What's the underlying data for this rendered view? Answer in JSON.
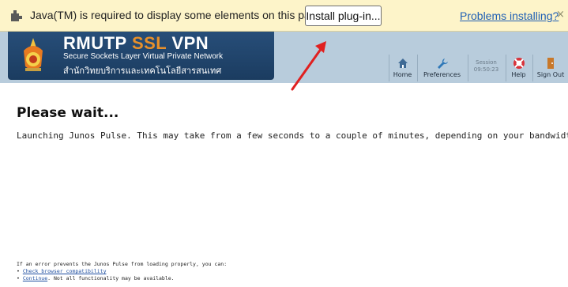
{
  "plugin_bar": {
    "message": "Java(TM) is required to display some elements on this page.",
    "install_label": "Install plug-in...",
    "problems_link": "Problems installing?",
    "close_glyph": "×",
    "icon": "puzzle-piece-icon"
  },
  "header": {
    "title_part1": "RMUTP ",
    "title_accent": "SSL",
    "title_part2": " VPN",
    "subtitle": "Secure Sockets Layer Virtual Private Network",
    "thai_name": "สำนักวิทยบริการและเทคโนโลยีสารสนเทศ",
    "colors": {
      "brand_bg": "#1b3c60",
      "accent": "#e8902a",
      "band": "#b8ccdc"
    }
  },
  "toolbar": {
    "home": "Home",
    "preferences": "Preferences",
    "session_label": "Session",
    "session_time": "09:50:23",
    "help": "Help",
    "signout": "Sign Out"
  },
  "main": {
    "headline": "Please wait...",
    "message": "Launching Junos Pulse. This may take from a few seconds to a couple of minutes, depending on your bandwidth."
  },
  "footer": {
    "intro": "If an error prevents the Junos Pulse from loading properly, you can:",
    "bullet1_link": "Check browser compatibility",
    "bullet2_link": "Continue",
    "bullet2_rest": ". Not all functionality may be available."
  }
}
